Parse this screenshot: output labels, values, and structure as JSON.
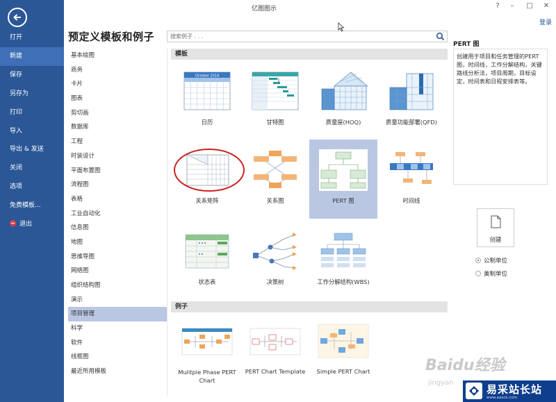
{
  "window": {
    "title": "亿图图示",
    "login": "登录",
    "controls": [
      "?",
      "–",
      "□",
      "✕"
    ]
  },
  "nav": {
    "items": [
      {
        "label": "打开"
      },
      {
        "label": "新建"
      },
      {
        "label": "保存"
      },
      {
        "label": "另存为"
      },
      {
        "label": "打印"
      },
      {
        "label": "导入"
      },
      {
        "label": "导出 & 发送"
      },
      {
        "label": "关闭"
      },
      {
        "label": "选项"
      },
      {
        "label": "免费模板..."
      },
      {
        "label": "退出"
      }
    ],
    "active": "新建"
  },
  "page": {
    "title": "预定义模板和例子"
  },
  "search": {
    "placeholder": "搜索例子 . . ."
  },
  "categories": [
    "基本绘图",
    "商务",
    "卡片",
    "图表",
    "剪切画",
    "数据库",
    "工程",
    "时装设计",
    "平面布置图",
    "流程图",
    "表格",
    "工业自动化",
    "信息图",
    "地图",
    "思维导图",
    "网络图",
    "组织结构图",
    "演示",
    "项目管理",
    "科学",
    "软件",
    "线框图",
    "最近所用模板"
  ],
  "selected_category": "项目管理",
  "sections": {
    "templates": "模板",
    "examples": "例子"
  },
  "templates": [
    {
      "label": "日历",
      "icon": "calendar-thumbnail"
    },
    {
      "label": "甘特图",
      "icon": "gantt-thumbnail"
    },
    {
      "label": "质量屋(HOQ)",
      "icon": "house-of-quality-thumbnail"
    },
    {
      "label": "质量功能部署(QFD)",
      "icon": "qfd-thumbnail"
    },
    {
      "label": "关系矩阵",
      "icon": "relation-matrix-thumbnail"
    },
    {
      "label": "关系图",
      "icon": "relation-diagram-thumbnail"
    },
    {
      "label": "PERT 图",
      "icon": "pert-thumbnail"
    },
    {
      "label": "时间线",
      "icon": "timeline-thumbnail"
    },
    {
      "label": "状态表",
      "icon": "state-table-thumbnail"
    },
    {
      "label": "决策树",
      "icon": "decision-tree-thumbnail"
    },
    {
      "label": "工作分解结构(WBS)",
      "icon": "wbs-thumbnail"
    }
  ],
  "selected_template": "PERT 图",
  "examples": [
    {
      "label": "Mulitple Phase PERT Chart"
    },
    {
      "label": "PERT Chart Template"
    },
    {
      "label": "Simple PERT Chart"
    }
  ],
  "detail": {
    "title": "PERT 图",
    "description": "创建用于项目和任务管理的PERT图，时间线，工作分解结构，关键路线分析法，项目周期，目标设定，时间表和日程安排表等。"
  },
  "create": {
    "label": "创建"
  },
  "units": [
    {
      "label": "公制单位",
      "selected": true
    },
    {
      "label": "美制单位",
      "selected": false
    }
  ],
  "calendar_thumb_text": "October 2014",
  "watermark": {
    "baidu": "Baidu经验",
    "brand": "易采站长站",
    "url": "www.easck.com",
    "sub": "jingyan"
  },
  "colors": {
    "nav": "#2b5797",
    "nav_active": "#3f6fb6",
    "selection": "#b9c7e3",
    "annotation_circle": "#cc2222"
  }
}
